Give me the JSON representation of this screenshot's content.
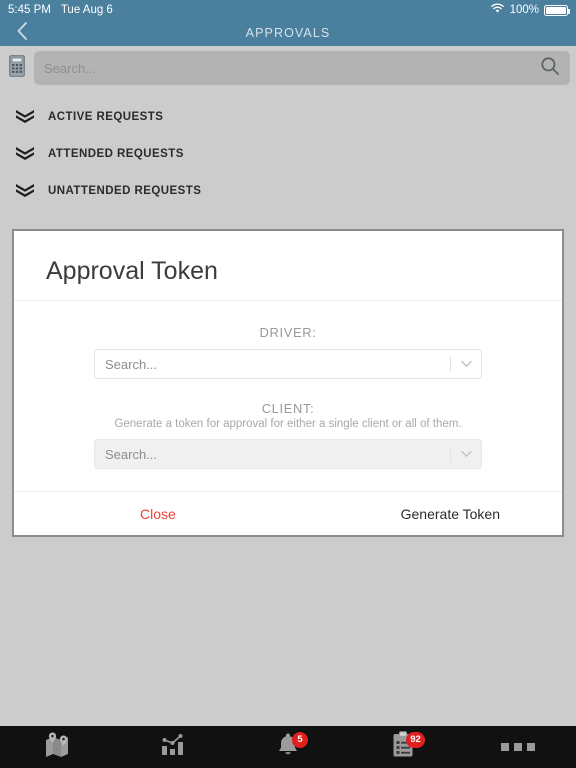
{
  "statusbar": {
    "time": "5:45 PM",
    "date": "Tue Aug 6",
    "battery_percent": "100%",
    "wifi_icon": "wifi-icon",
    "battery_icon": "battery-icon"
  },
  "navbar": {
    "back_icon": "chevron-left-icon",
    "title": "APPROVALS"
  },
  "search": {
    "left_icon": "calculator-icon",
    "placeholder": "Search...",
    "search_icon": "search-icon"
  },
  "requests": {
    "items": [
      {
        "label": "ACTIVE REQUESTS",
        "icon": "triple-chevron-down-icon"
      },
      {
        "label": "ATTENDED REQUESTS",
        "icon": "triple-chevron-down-icon"
      },
      {
        "label": "UNATTENDED REQUESTS",
        "icon": "triple-chevron-down-icon"
      }
    ]
  },
  "modal": {
    "title": "Approval Token",
    "driver": {
      "label": "DRIVER:",
      "placeholder": "Search...",
      "value": "Search...",
      "caret_icon": "chevron-down-icon",
      "disabled": false
    },
    "client": {
      "label": "CLIENT:",
      "hint": "Generate a token for approval for either a single client or all of them.",
      "placeholder": "Search...",
      "value": "Search...",
      "caret_icon": "chevron-down-icon",
      "disabled": true
    },
    "close_label": "Close",
    "generate_label": "Generate Token"
  },
  "tabbar": {
    "items": [
      {
        "name": "tab-map",
        "icon": "map-pins-icon",
        "badge": ""
      },
      {
        "name": "tab-analytics",
        "icon": "bar-chart-icon",
        "badge": ""
      },
      {
        "name": "tab-notifications",
        "icon": "bell-icon",
        "badge": "5"
      },
      {
        "name": "tab-approvals",
        "icon": "clipboard-icon",
        "badge": "92"
      },
      {
        "name": "tab-more",
        "icon": "more-dots-icon",
        "badge": ""
      }
    ]
  },
  "colors": {
    "header_blue": "#4a7f9e",
    "page_gray": "#cccccc",
    "accent_red": "#ef4136",
    "badge_red": "#e01f1f",
    "tabbar_black": "#111111"
  }
}
